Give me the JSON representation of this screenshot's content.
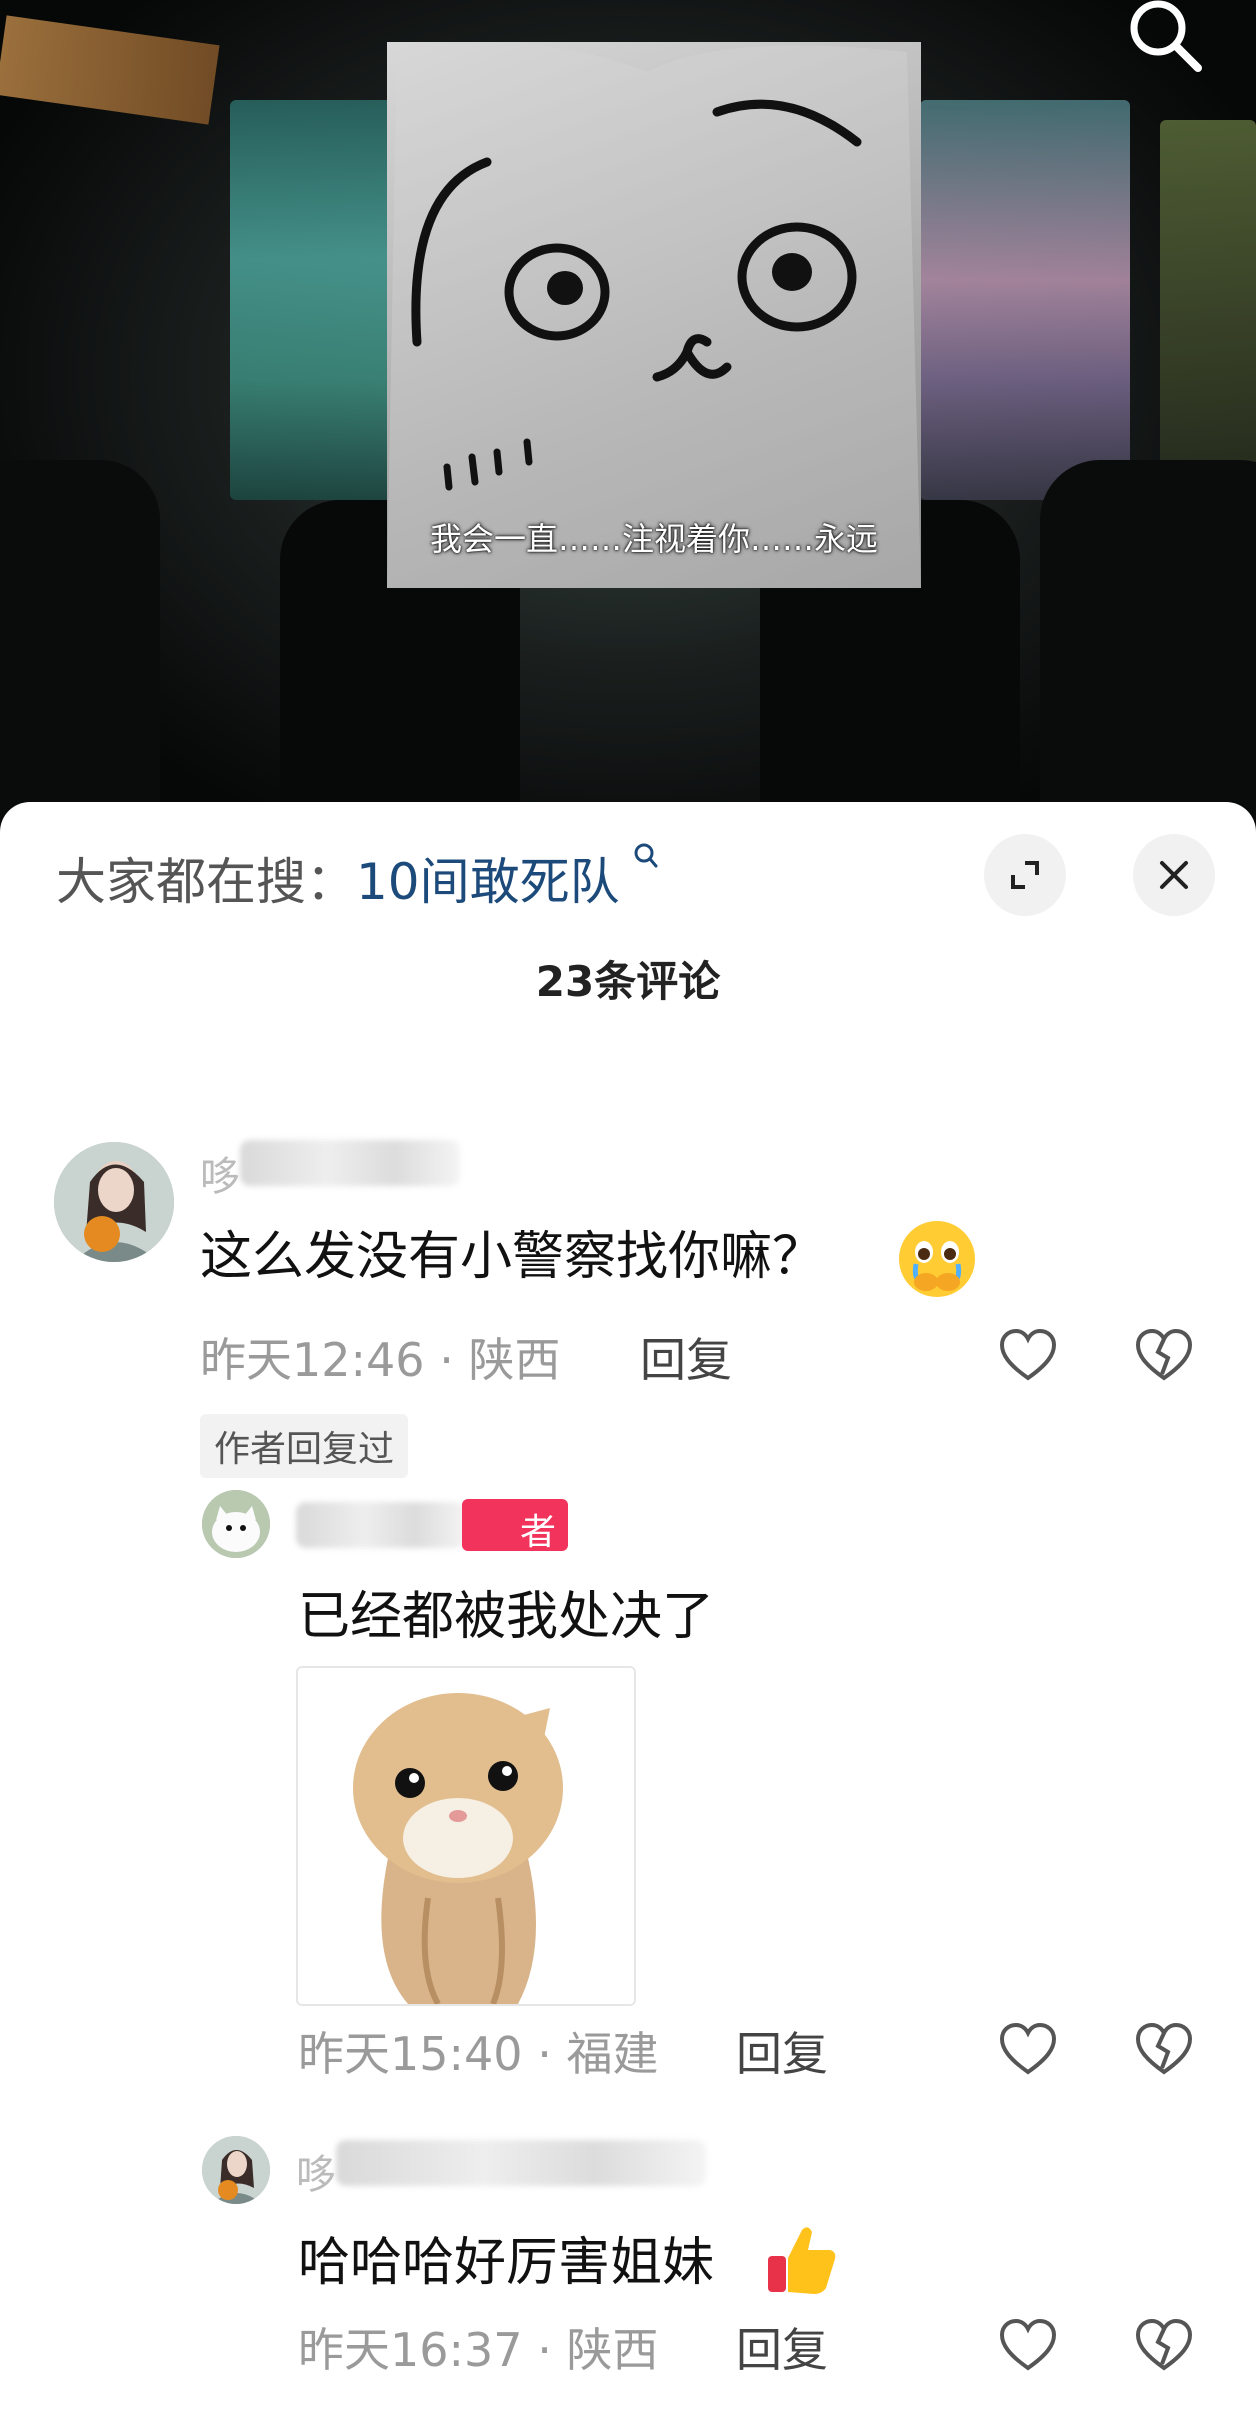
{
  "video": {
    "meme_caption": "我会一直……注视着你……永远"
  },
  "sheet": {
    "hot_search_prefix": "大家都在搜：",
    "hot_search_term": "10间敢死队",
    "comment_count_title": "23条评论",
    "collapse_label": "收起"
  },
  "comments": [
    {
      "name_hint": "哆",
      "text": "这么发没有小警察找你嘛？",
      "time": "昨天12:46",
      "location": "陕西",
      "reply_label": "回复",
      "tag": "作者回复过"
    },
    {
      "name_hint": "",
      "author_badge": "者",
      "text": "已经都被我处决了",
      "time": "昨天15:40",
      "location": "福建",
      "reply_label": "回复"
    },
    {
      "name_hint": "哆",
      "text": "哈哈哈好厉害姐妹",
      "time": "昨天16:37",
      "location": "陕西",
      "reply_label": "回复"
    }
  ],
  "separator": "·",
  "icons": [
    "search-icon",
    "search-small-icon",
    "expand-icon",
    "close-icon",
    "heart-icon",
    "broken-heart-icon",
    "crying-emoji-icon",
    "thumbs-up-emoji-icon"
  ],
  "colors": {
    "accent_link": "#1c4a7a",
    "author_badge": "#f2335c",
    "meta_gray": "#9a9a9a"
  }
}
